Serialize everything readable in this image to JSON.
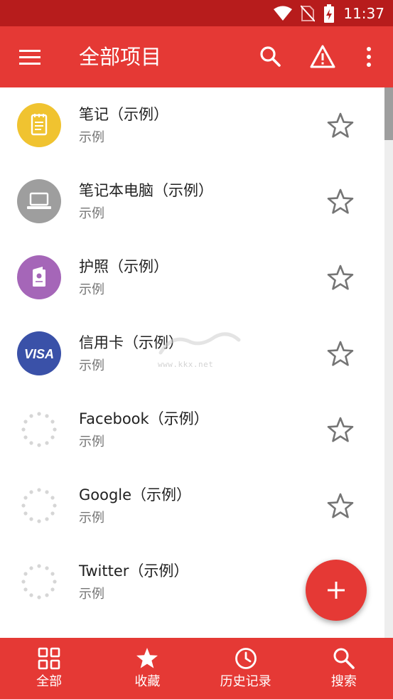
{
  "status_bar": {
    "time": "11:37"
  },
  "app_bar": {
    "title": "全部项目"
  },
  "items": [
    {
      "title": "笔记（示例）",
      "subtitle": "示例",
      "icon": "notepad-icon",
      "color": "#f0c330"
    },
    {
      "title": "笔记本电脑（示例）",
      "subtitle": "示例",
      "icon": "laptop-icon",
      "color": "#9e9e9e"
    },
    {
      "title": "护照（示例）",
      "subtitle": "示例",
      "icon": "passport-icon",
      "color": "#a566b8"
    },
    {
      "title": "信用卡（示例）",
      "subtitle": "示例",
      "icon": "visa-icon",
      "color": "#3a51a8",
      "logo_text": "VISA"
    },
    {
      "title": "Facebook（示例）",
      "subtitle": "示例",
      "icon": "loading-icon"
    },
    {
      "title": "Google（示例）",
      "subtitle": "示例",
      "icon": "loading-icon"
    },
    {
      "title": "Twitter（示例）",
      "subtitle": "示例",
      "icon": "loading-icon"
    }
  ],
  "watermark": {
    "text": "www.kkx.net"
  },
  "bottom_nav": [
    {
      "label": "全部",
      "icon": "grid-icon"
    },
    {
      "label": "收藏",
      "icon": "star-icon"
    },
    {
      "label": "历史记录",
      "icon": "clock-icon"
    },
    {
      "label": "搜索",
      "icon": "search-icon"
    }
  ],
  "colors": {
    "primary": "#e53935",
    "status_bar": "#b71c1c",
    "star_outline": "#757575"
  }
}
